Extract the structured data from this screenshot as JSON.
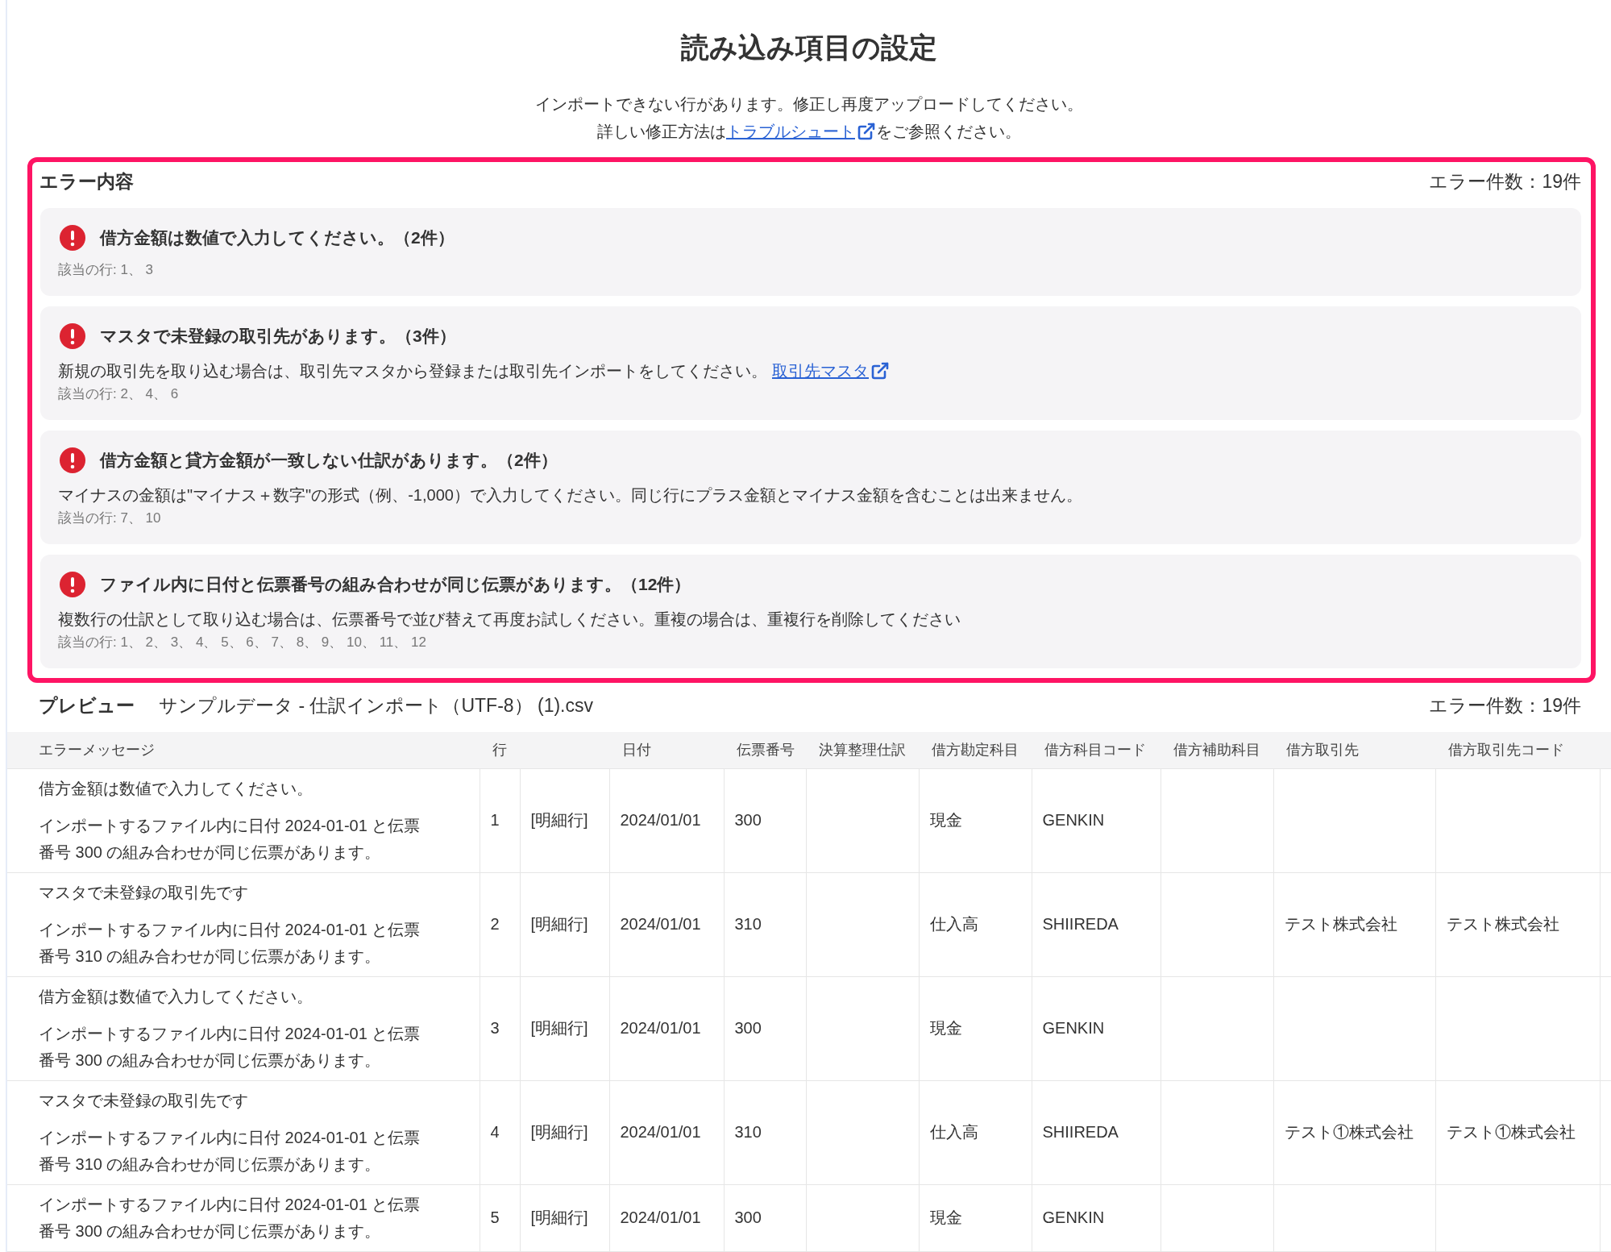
{
  "page": {
    "title": "読み込み項目の設定",
    "notice": "インポートできない行があります。修正し再度アップロードしてください。",
    "help": {
      "text_before": "詳しい修正方法は",
      "link": "トラブルシュート",
      "text_after": "をご参照ください。"
    }
  },
  "errors": {
    "heading": "エラー内容",
    "count": "エラー件数：19件",
    "items": [
      {
        "title": "借方金額は数値で入力してください。（2件）",
        "rows": "該当の行: 1、 3"
      },
      {
        "title": "マスタで未登録の取引先があります。（3件）",
        "description": "新規の取引先を取り込む場合は、取引先マスタから登録または取引先インポートをしてください。",
        "link": "取引先マスタ",
        "rows": "該当の行: 2、 4、 6"
      },
      {
        "title": "借方金額と貸方金額が一致しない仕訳があります。（2件）",
        "description": "マイナスの金額は\"マイナス＋数字\"の形式（例、-1,000）で入力してください。同じ行にプラス金額とマイナス金額を含むことは出来ません。",
        "rows": "該当の行: 7、 10"
      },
      {
        "title": "ファイル内に日付と伝票番号の組み合わせが同じ伝票があります。（12件）",
        "description": "複数行の仕訳として取り込む場合は、伝票番号で並び替えて再度お試しください。重複の場合は、重複行を削除してください",
        "rows": "該当の行: 1、 2、 3、 4、 5、 6、 7、 8、 9、 10、 11、 12"
      }
    ]
  },
  "preview": {
    "heading": "プレビュー",
    "file_name": "サンプルデータ - 仕訳インポート（UTF-8） (1).csv",
    "count": "エラー件数：19件"
  },
  "table": {
    "columns": {
      "error_messages": "エラーメッセージ",
      "row": "行",
      "date": "日付",
      "slip_number": "伝票番号",
      "closing_entry": "決算整理仕訳",
      "debit_account": "借方勘定科目",
      "debit_account_code": "借方科目コード",
      "debit_sub_account": "借方補助科目",
      "debit_partner": "借方取引先",
      "debit_partner_code": "借方取引先コード"
    },
    "rows": [
      {
        "error_messages": [
          "借方金額は数値で入力してください。",
          "インポートするファイル内に日付 2024-01-01 と伝票番号 300 の組み合わせが同じ伝票があります。"
        ],
        "row": "1",
        "column_3": "[明細行]",
        "date": "2024/01/01",
        "slip_number": "300",
        "debit_account": "現金",
        "debit_account_code": "GENKIN"
      },
      {
        "error_messages": [
          "マスタで未登録の取引先です",
          "インポートするファイル内に日付 2024-01-01 と伝票番号 310 の組み合わせが同じ伝票があります。"
        ],
        "row": "2",
        "column_3": "[明細行]",
        "date": "2024/01/01",
        "slip_number": "310",
        "debit_account": "仕入高",
        "debit_account_code": "SHIIREDA",
        "debit_partner": "テスト株式会社",
        "debit_partner_code": "テスト株式会社"
      },
      {
        "error_messages": [
          "借方金額は数値で入力してください。",
          "インポートするファイル内に日付 2024-01-01 と伝票番号 300 の組み合わせが同じ伝票があります。"
        ],
        "row": "3",
        "column_3": "[明細行]",
        "date": "2024/01/01",
        "slip_number": "300",
        "debit_account": "現金",
        "debit_account_code": "GENKIN"
      },
      {
        "error_messages": [
          "マスタで未登録の取引先です",
          "インポートするファイル内に日付 2024-01-01 と伝票番号 310 の組み合わせが同じ伝票があります。"
        ],
        "row": "4",
        "column_3": "[明細行]",
        "date": "2024/01/01",
        "slip_number": "310",
        "debit_account": "仕入高",
        "debit_account_code": "SHIIREDA",
        "debit_partner": "テスト①株式会社",
        "debit_partner_code": "テスト①株式会社"
      },
      {
        "error_messages": [
          "インポートするファイル内に日付 2024-01-01 と伝票番号 300 の組み合わせが同じ伝票があります。"
        ],
        "row": "5",
        "column_3": "[明細行]",
        "date": "2024/01/01",
        "slip_number": "300",
        "debit_account": "現金",
        "debit_account_code": "GENKIN"
      }
    ]
  }
}
